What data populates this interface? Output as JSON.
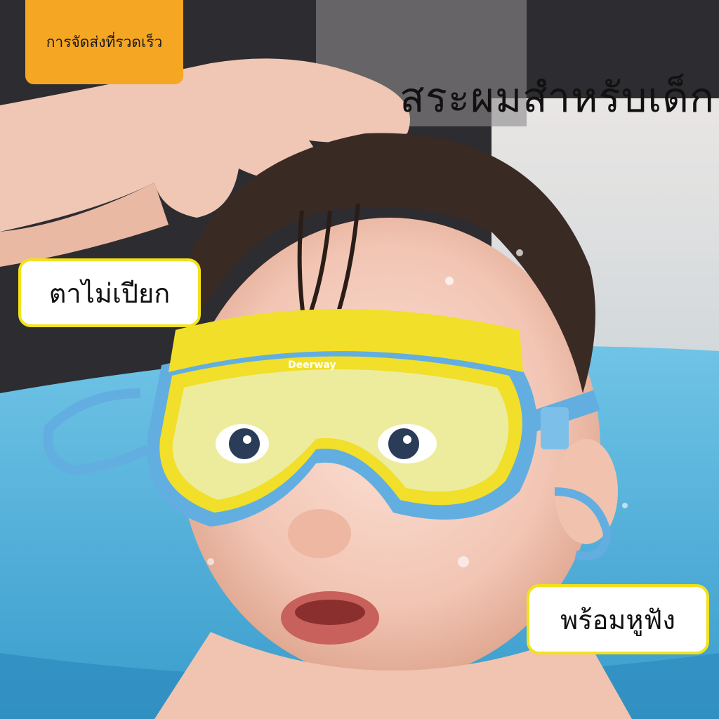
{
  "badge": {
    "text": "การจัดส่งที่รวดเร็ว"
  },
  "headline": {
    "text": "สระผมสำหรับเด็ก"
  },
  "callouts": {
    "eyes": "ตาไม่เปียก",
    "ears": "พร้อมหูฟัง"
  },
  "product": {
    "logo_text": "Deerway"
  },
  "colors": {
    "badge": "#f5a623",
    "bubble_border": "#f2e21a",
    "goggle_frame": "#63aee0",
    "goggle_lining": "#f1df2a",
    "tub": "#4fb3d9"
  }
}
